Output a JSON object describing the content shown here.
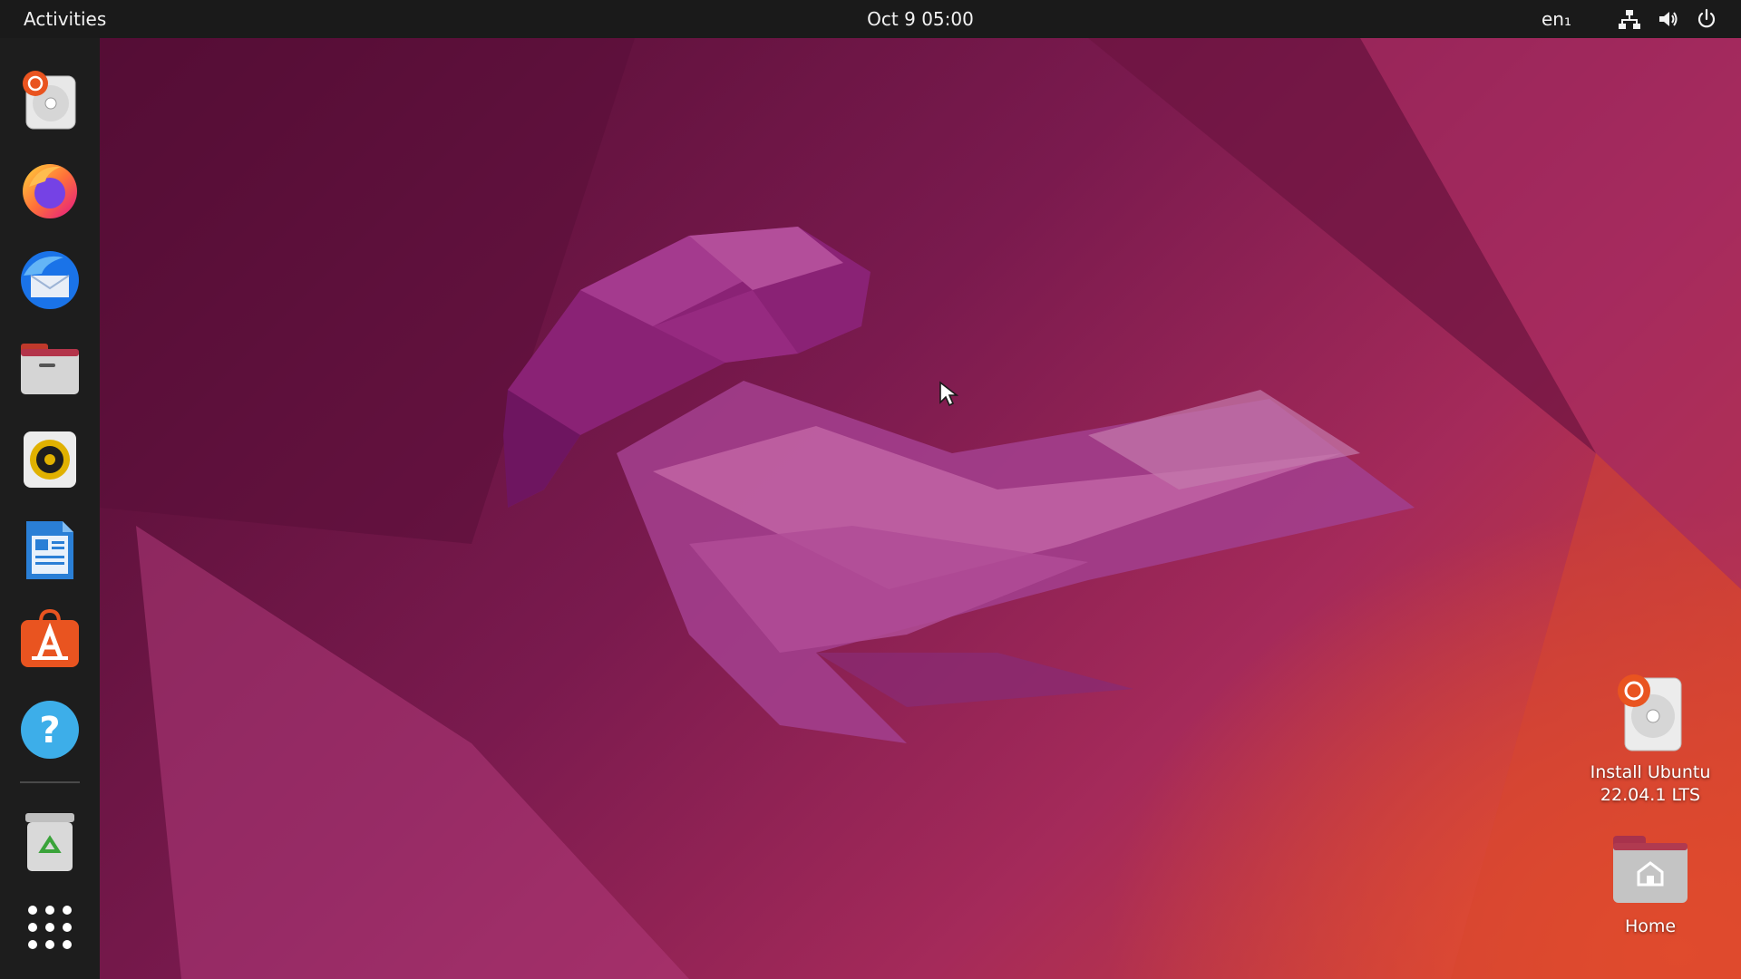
{
  "top_bar": {
    "activities_label": "Activities",
    "clock": "Oct 9  05:00",
    "input_language": "en₁",
    "tray_icons": [
      "network-icon",
      "volume-icon",
      "power-icon"
    ]
  },
  "dock": {
    "items": [
      {
        "name": "install-ubuntu",
        "icon": "installer-disc-icon"
      },
      {
        "name": "firefox",
        "icon": "firefox-icon"
      },
      {
        "name": "thunderbird",
        "icon": "thunderbird-icon"
      },
      {
        "name": "files",
        "icon": "folder-icon"
      },
      {
        "name": "rhythmbox",
        "icon": "speaker-icon"
      },
      {
        "name": "libreoffice-writer",
        "icon": "document-icon"
      },
      {
        "name": "ubuntu-software",
        "icon": "software-store-icon"
      },
      {
        "name": "help",
        "icon": "help-icon"
      },
      {
        "name": "trash",
        "icon": "trash-icon"
      },
      {
        "name": "show-applications",
        "icon": "app-grid-icon"
      }
    ]
  },
  "desktop": {
    "icons": [
      {
        "label": "Install Ubuntu\n22.04.1 LTS",
        "line1": "Install Ubuntu",
        "line2": "22.04.1 LTS",
        "icon": "installer-disc-icon"
      },
      {
        "label": "Home",
        "icon": "home-folder-icon"
      }
    ]
  },
  "colors": {
    "top_bar": "#1a1a1a",
    "dock": "#1d1d1d",
    "wallpaper_dark": "#4a0a2e",
    "wallpaper_mid": "#a52a5a",
    "wallpaper_orange": "#e8502c",
    "ubuntu_orange": "#e95420"
  }
}
